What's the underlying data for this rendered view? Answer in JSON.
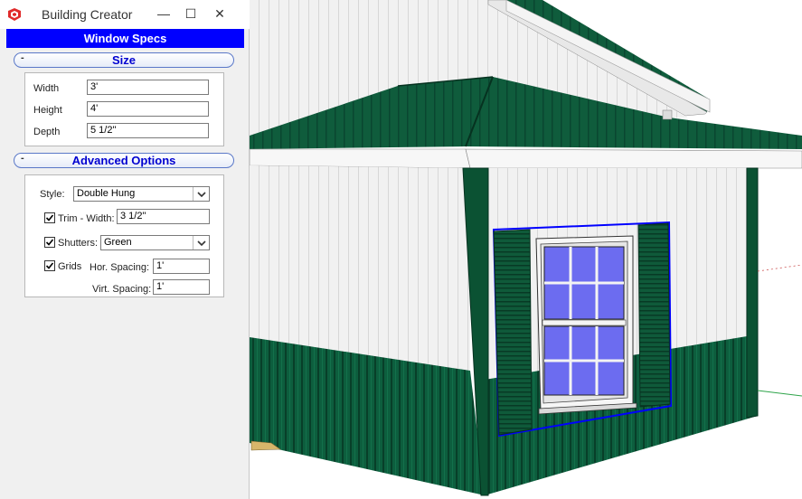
{
  "window": {
    "title": "Building Creator",
    "minimize_glyph": "—",
    "maximize_glyph": "☐",
    "close_glyph": "✕"
  },
  "header": {
    "title": "Window Specs"
  },
  "size_section": {
    "toggle": "-",
    "title": "Size",
    "fields": [
      {
        "label": "Width",
        "value": "3'"
      },
      {
        "label": "Height",
        "value": "4'"
      },
      {
        "label": "Depth",
        "value": "5 1/2\""
      }
    ]
  },
  "advanced_section": {
    "toggle": "-",
    "title": "Advanced Options",
    "style_label": "Style:",
    "style_value": "Double Hung",
    "trim_label": "Trim - Width:",
    "trim_checked": true,
    "trim_value": "3 1/2\"",
    "shutters_label": "Shutters:",
    "shutters_checked": true,
    "shutters_value": "Green",
    "grids_label": "Grids",
    "grids_checked": true,
    "hor_label": "Hor. Spacing:",
    "hor_value": "1'",
    "vert_label": "Virt. Spacing:",
    "vert_value": "1'"
  },
  "icons": {
    "app": "sketchup-icon",
    "dropdown": "chevron-down-icon",
    "check": "check-icon"
  },
  "colors": {
    "header_blue": "#0000ff",
    "section_title": "#0000d0",
    "siding_green": "#0b5b3c",
    "wall_white": "#eeeeee",
    "glass_blue": "#6a6af0",
    "selection_blue": "#0000ff"
  }
}
